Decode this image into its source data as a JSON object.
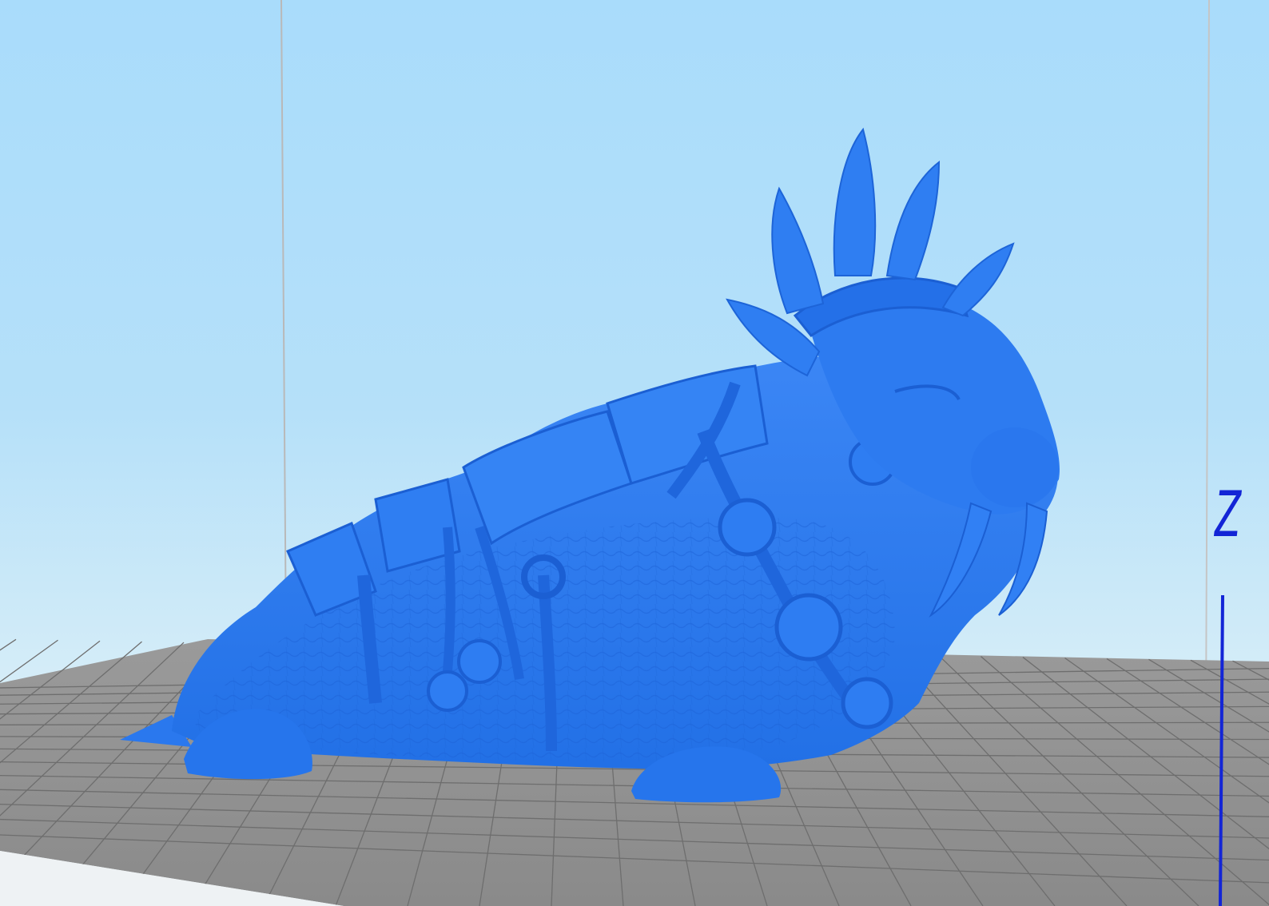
{
  "viewport": {
    "background_top": "#a9dcfb",
    "background_bottom": "#e7f2f6",
    "bed_color": "#8c8c8c",
    "bed_grid_color": "#6e6e6e",
    "model_color": "#2979f2",
    "model_shade_color": "#1c5fd0",
    "axis_color": "#1325d6"
  },
  "model": {
    "name": "walrus-warrior"
  },
  "axis": {
    "z_label": "Z"
  }
}
